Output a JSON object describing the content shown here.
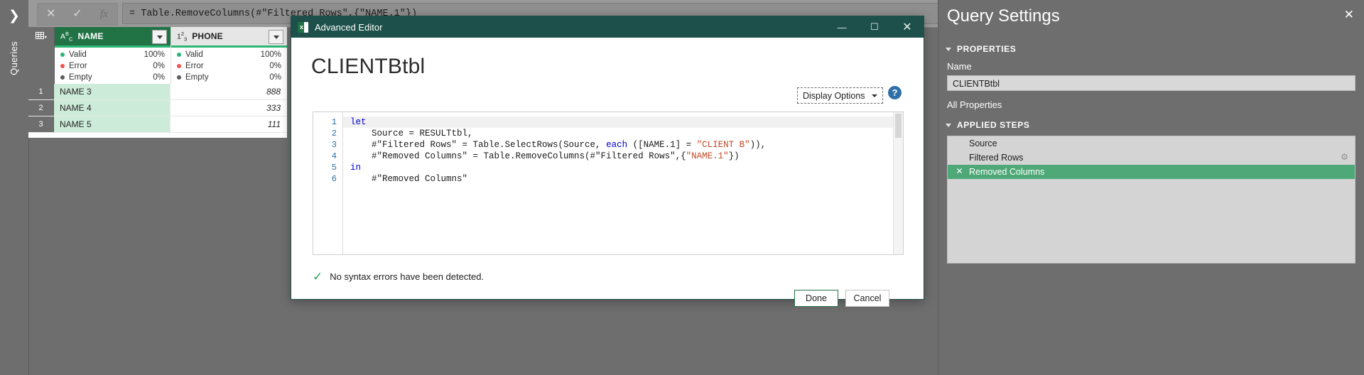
{
  "workspace": {
    "queries_rail_label": "Queries",
    "expand_icon": "chevron-right"
  },
  "formula_bar": {
    "cancel_icon": "✕",
    "accept_icon": "✓",
    "fx_icon": "fx",
    "formula": "= Table.RemoveColumns(#\"Filtered Rows\",{\"NAME.1\"})"
  },
  "grid": {
    "columns": [
      {
        "name": "NAME",
        "type_icon": "ABC",
        "selected": true,
        "quality": [
          {
            "label": "Valid",
            "value": "100%",
            "color": "#2bb673"
          },
          {
            "label": "Error",
            "value": "0%",
            "color": "#ef5350"
          },
          {
            "label": "Empty",
            "value": "0%",
            "color": "#5a5a5a"
          }
        ]
      },
      {
        "name": "PHONE",
        "type_icon": "123",
        "selected": false,
        "quality": [
          {
            "label": "Valid",
            "value": "100%",
            "color": "#2bb673"
          },
          {
            "label": "Error",
            "value": "0%",
            "color": "#ef5350"
          },
          {
            "label": "Empty",
            "value": "0%",
            "color": "#5a5a5a"
          }
        ]
      }
    ],
    "rows": [
      {
        "num": "1",
        "name": "NAME 3",
        "phone": "888"
      },
      {
        "num": "2",
        "name": "NAME 4",
        "phone": "333"
      },
      {
        "num": "3",
        "name": "NAME 5",
        "phone": "111"
      }
    ]
  },
  "advanced_editor": {
    "window_title": "Advanced Editor",
    "app_icon": "excel-icon",
    "minimize_label": "—",
    "maximize_label": "☐",
    "close_label": "✕",
    "query_name": "CLIENTBtbl",
    "display_options_label": "Display Options",
    "help_label": "?",
    "code": {
      "line_numbers": [
        "1",
        "2",
        "3",
        "4",
        "5",
        "6"
      ],
      "lines": [
        [
          {
            "t": "let",
            "c": "kw"
          }
        ],
        [
          {
            "t": "    Source = RESULTtbl,",
            "c": ""
          }
        ],
        [
          {
            "t": "    #\"Filtered Rows\" = Table.SelectRows(Source, ",
            "c": ""
          },
          {
            "t": "each",
            "c": "kw"
          },
          {
            "t": " ([NAME.1] = ",
            "c": ""
          },
          {
            "t": "\"CLIENT B\"",
            "c": "str"
          },
          {
            "t": ")),",
            "c": ""
          }
        ],
        [
          {
            "t": "    #\"Removed Columns\" = Table.RemoveColumns(#\"Filtered Rows\",{",
            "c": ""
          },
          {
            "t": "\"NAME.1\"",
            "c": "str"
          },
          {
            "t": "})",
            "c": ""
          }
        ],
        [
          {
            "t": "in",
            "c": "kw"
          }
        ],
        [
          {
            "t": "    #\"Removed Columns\"",
            "c": ""
          }
        ]
      ]
    },
    "status_text": "No syntax errors have been detected.",
    "status_icon": "checkmark-icon",
    "status_color": "#2e9f5b",
    "done_label": "Done",
    "cancel_label": "Cancel"
  },
  "query_settings": {
    "title": "Query Settings",
    "close_label": "✕",
    "properties_heading": "PROPERTIES",
    "name_label": "Name",
    "name_value": "CLIENTBtbl",
    "all_properties_label": "All Properties",
    "applied_steps_heading": "APPLIED STEPS",
    "steps": [
      {
        "label": "Source",
        "active": false,
        "has_gear": false,
        "has_delete": false
      },
      {
        "label": "Filtered Rows",
        "active": false,
        "has_gear": true,
        "has_delete": false
      },
      {
        "label": "Removed Columns",
        "active": true,
        "has_gear": false,
        "has_delete": true
      }
    ]
  },
  "colors": {
    "accent_green": "#217346",
    "step_active": "#4ea877",
    "title_bar": "#1d504a",
    "chrome_gray": "#6e6e6e"
  }
}
